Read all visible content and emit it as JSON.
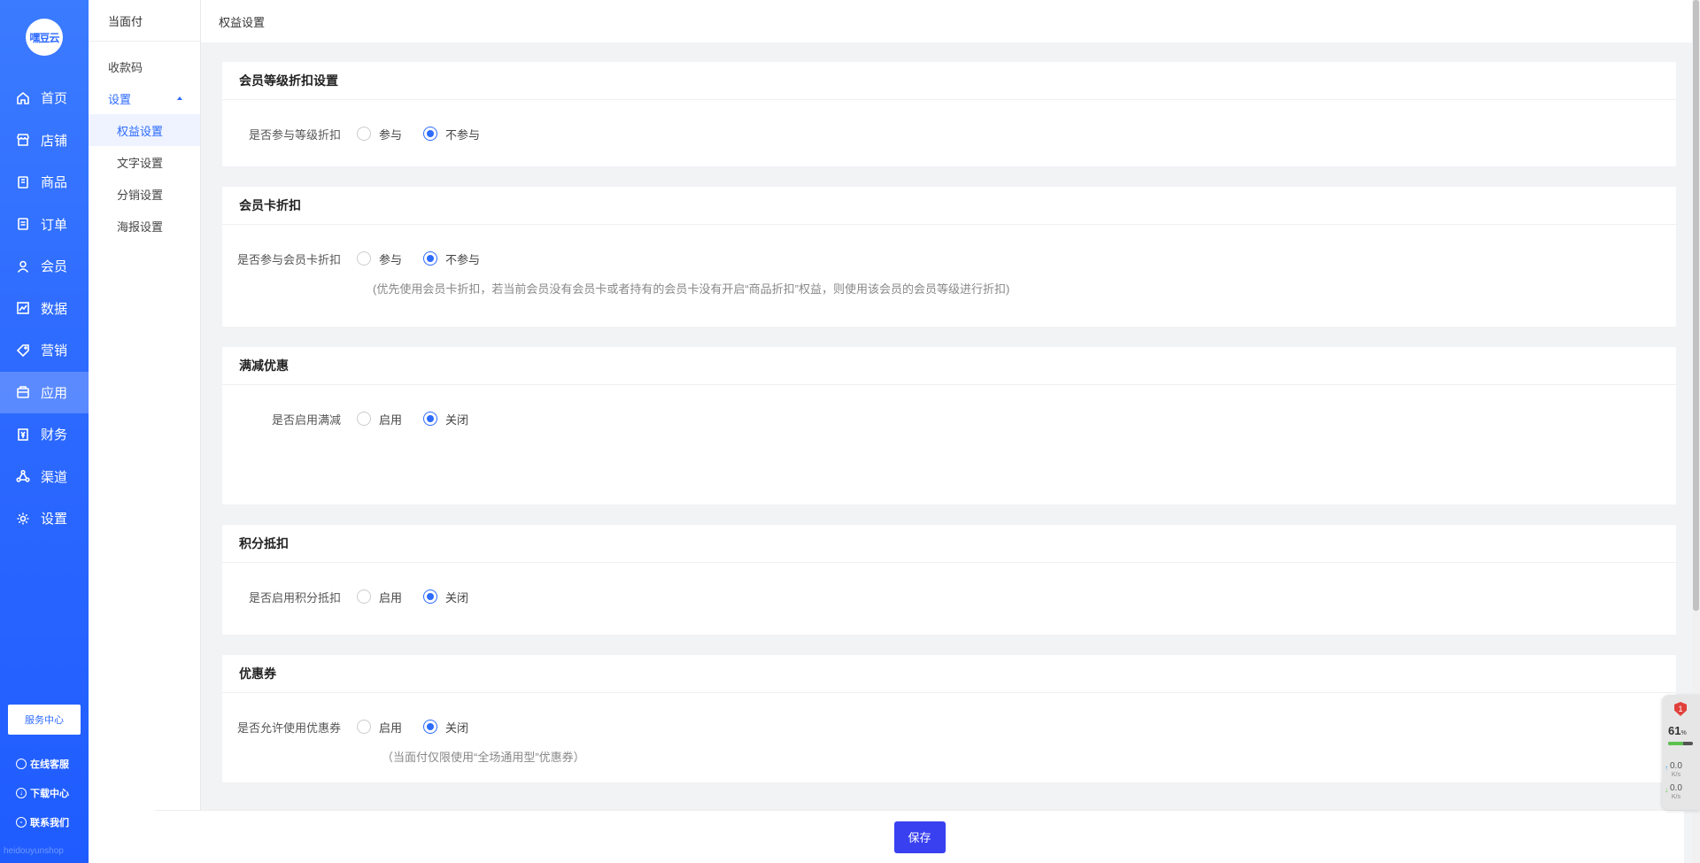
{
  "sidebar": {
    "logo_text": "嘿豆云",
    "items": [
      {
        "label": "首页",
        "icon": "home-icon"
      },
      {
        "label": "店铺",
        "icon": "store-icon"
      },
      {
        "label": "商品",
        "icon": "goods-icon"
      },
      {
        "label": "订单",
        "icon": "order-icon"
      },
      {
        "label": "会员",
        "icon": "member-icon"
      },
      {
        "label": "数据",
        "icon": "data-icon"
      },
      {
        "label": "营销",
        "icon": "tag-icon"
      },
      {
        "label": "应用",
        "icon": "app-icon"
      },
      {
        "label": "财务",
        "icon": "finance-icon"
      },
      {
        "label": "渠道",
        "icon": "channel-icon"
      },
      {
        "label": "设置",
        "icon": "gear-icon"
      }
    ],
    "active_index": 7,
    "service_button": "服务中心",
    "links": [
      "在线客服",
      "下载中心",
      "联系我们"
    ],
    "watermark": "heidouyunshop"
  },
  "submenu": {
    "header": "当面付",
    "items": [
      "收款码",
      "设置",
      "权益设置",
      "文字设置",
      "分销设置",
      "海报设置"
    ]
  },
  "topbar": {
    "title": "权益设置"
  },
  "sections": {
    "level": {
      "title": "会员等级折扣设置",
      "label": "是否参与等级折扣",
      "option_a": "参与",
      "option_b": "不参与"
    },
    "card": {
      "title": "会员卡折扣",
      "label": "是否参与会员卡折扣",
      "option_a": "参与",
      "option_b": "不参与",
      "hint": "(优先使用会员卡折扣，若当前会员没有会员卡或者持有的会员卡没有开启“商品折扣”权益，则使用该会员的会员等级进行折扣)"
    },
    "fullcut": {
      "title": "满减优惠",
      "label": "是否启用满减",
      "option_a": "启用",
      "option_b": "关闭"
    },
    "points": {
      "title": "积分抵扣",
      "label": "是否启用积分抵扣",
      "option_a": "启用",
      "option_b": "关闭"
    },
    "coupon": {
      "title": "优惠券",
      "label": "是否允许使用优惠券",
      "option_a": "启用",
      "option_b": "关闭",
      "hint": "（当面付仅限使用“全场通用型”优惠券）"
    }
  },
  "footer": {
    "save_label": "保存"
  },
  "net_widget": {
    "badge": "1",
    "percent": "61",
    "percent_unit": "%",
    "up_speed": "0.0",
    "down_speed": "0.0",
    "speed_unit": "K/s"
  },
  "colors": {
    "primary": "#2e6bff",
    "save_button": "#3940f0"
  }
}
